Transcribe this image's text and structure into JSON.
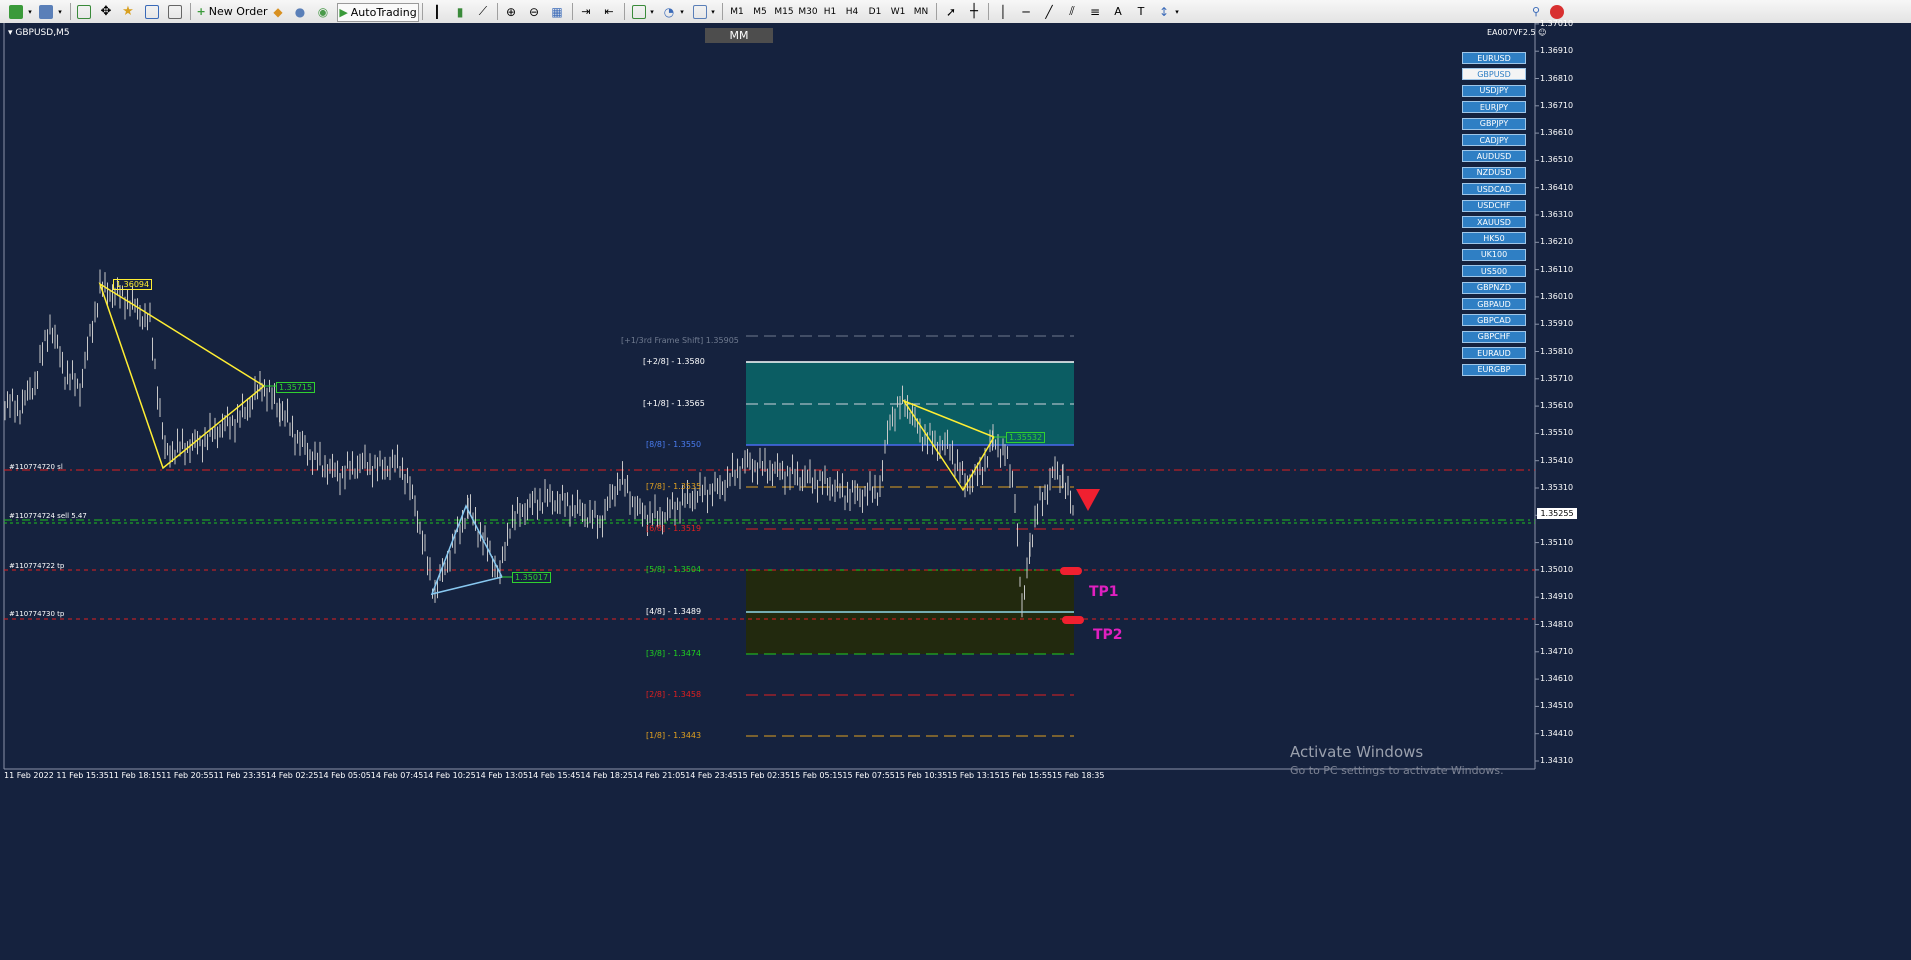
{
  "toolbar": {
    "new_order": "New Order",
    "auto_trading": "AutoTrading",
    "timeframes": [
      "M1",
      "M5",
      "M15",
      "M30",
      "H1",
      "H4",
      "D1",
      "W1",
      "MN"
    ]
  },
  "chart": {
    "title": "GBPUSD,M5",
    "mm_button": "MM",
    "ea_label": "EA007VF2.5",
    "current_price": "1.35255",
    "pairs": [
      "EURUSD",
      "GBPUSD",
      "USDJPY",
      "EURJPY",
      "GBPJPY",
      "CADJPY",
      "AUDUSD",
      "NZDUSD",
      "USDCAD",
      "USDCHF",
      "XAUUSD",
      "HK50",
      "UK100",
      "US500",
      "GBPNZD",
      "GBPAUD",
      "GBPCAD",
      "GBPCHF",
      "EURAUD",
      "EURGBP"
    ],
    "active_pair": "GBPUSD",
    "price_axis": [
      "1.37010",
      "1.36910",
      "1.36810",
      "1.36710",
      "1.36610",
      "1.36510",
      "1.36410",
      "1.36310",
      "1.36210",
      "1.36110",
      "1.36010",
      "1.35910",
      "1.35810",
      "1.35710",
      "1.35610",
      "1.35510",
      "1.35410",
      "1.35310",
      "1.35255",
      "1.35210",
      "1.35110",
      "1.35010",
      "1.34910",
      "1.34810",
      "1.34710",
      "1.34610",
      "1.34510",
      "1.34410",
      "1.34310"
    ],
    "time_axis": [
      "11 Feb 2022",
      "11 Feb 15:35",
      "11 Feb 18:15",
      "11 Feb 20:55",
      "11 Feb 23:35",
      "14 Feb 02:25",
      "14 Feb 05:05",
      "14 Feb 07:45",
      "14 Feb 10:25",
      "14 Feb 13:05",
      "14 Feb 15:45",
      "14 Feb 18:25",
      "14 Feb 21:05",
      "14 Feb 23:45",
      "15 Feb 02:35",
      "15 Feb 05:15",
      "15 Feb 07:55",
      "15 Feb 10:35",
      "15 Feb 13:15",
      "15 Feb 15:55",
      "15 Feb 18:35"
    ],
    "frame_shift_label": "[+1/3rd Frame Shift]  1.35905",
    "murrey": [
      {
        "text": "[+2/8] - 1.3580",
        "color": "#ffffff"
      },
      {
        "text": "[+1/8] - 1.3565",
        "color": "#ffffff"
      },
      {
        "text": "[8/8] - 1.3550",
        "color": "#4a7cf0"
      },
      {
        "text": "[7/8] - 1.3535",
        "color": "#e0a020"
      },
      {
        "text": "[6/8] - 1.3519",
        "color": "#e02020"
      },
      {
        "text": "[5/8] - 1.3504",
        "color": "#20d020"
      },
      {
        "text": "[4/8] - 1.3489",
        "color": "#ffffff"
      },
      {
        "text": "[3/8] - 1.3474",
        "color": "#20d020"
      },
      {
        "text": "[2/8] - 1.3458",
        "color": "#e02020"
      },
      {
        "text": "[1/8] - 1.3443",
        "color": "#e0a020"
      }
    ],
    "pattern_tags": [
      "1.36094",
      "1.35715",
      "1.35017",
      "1.35532"
    ],
    "order_labels": [
      "#110774720 sl",
      "#110774724 sell 5.47",
      "#110774722 tp",
      "#110774730 tp"
    ],
    "tp_labels": [
      "TP1",
      "TP2"
    ],
    "watermark_title": "Activate Windows",
    "watermark_sub": "Go to PC settings to activate Windows."
  }
}
